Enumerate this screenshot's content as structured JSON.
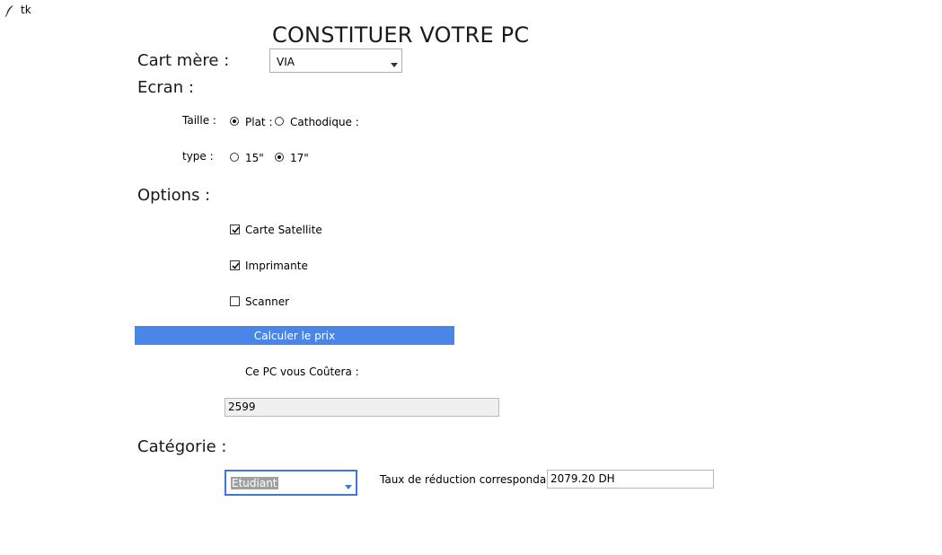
{
  "window": {
    "title": "tk",
    "icon": "feather-icon"
  },
  "page": {
    "title": "CONSTITUER VOTRE PC"
  },
  "motherboard": {
    "label": "Cart mère :",
    "selected": "VIA"
  },
  "screen": {
    "label": "Ecran :",
    "size": {
      "label": "Taille :",
      "options": [
        {
          "label": "Plat :",
          "checked": true
        },
        {
          "label": "Cathodique :",
          "checked": false
        }
      ]
    },
    "type": {
      "label": "type :",
      "options": [
        {
          "label": "15\"",
          "checked": false
        },
        {
          "label": "17\"",
          "checked": true
        }
      ]
    }
  },
  "options": {
    "label": "Options :",
    "items": [
      {
        "label": "Carte Satellite",
        "checked": true
      },
      {
        "label": "Imprimante",
        "checked": true
      },
      {
        "label": "Scanner",
        "checked": false
      }
    ]
  },
  "calculate": {
    "label": "Calculer le prix"
  },
  "price": {
    "label": "Ce PC vous Coûtera :",
    "value": "2599"
  },
  "category": {
    "label": "Catégorie :",
    "selected": "Etudiant",
    "discount_label": "Taux de réduction correspondant :",
    "discount_value": "2079.20 DH"
  }
}
